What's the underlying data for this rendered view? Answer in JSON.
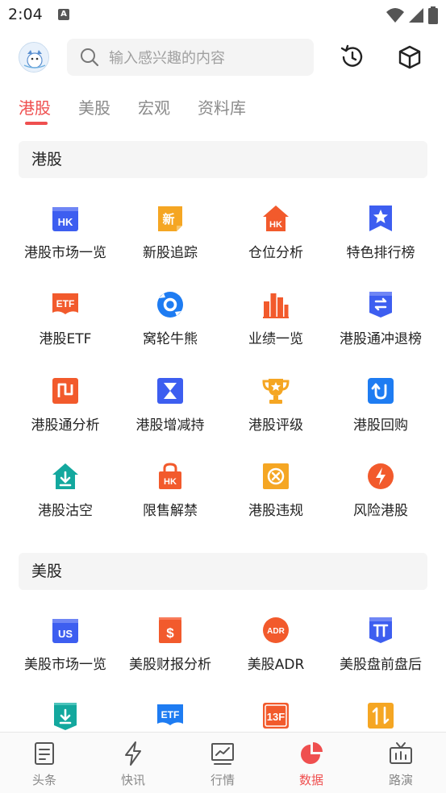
{
  "status": {
    "time": "2:04",
    "notif_badge": "A"
  },
  "search": {
    "placeholder": "输入感兴趣的内容"
  },
  "tabs": [
    {
      "label": "港股",
      "active": true
    },
    {
      "label": "美股",
      "active": false
    },
    {
      "label": "宏观",
      "active": false
    },
    {
      "label": "资料库",
      "active": false
    }
  ],
  "hk": {
    "title": "港股",
    "items": [
      {
        "label": "港股市场一览",
        "icon": "hk-market-icon",
        "glyph": "HK"
      },
      {
        "label": "新股追踪",
        "icon": "new-stock-icon",
        "glyph": "新"
      },
      {
        "label": "仓位分析",
        "icon": "position-analysis-icon",
        "glyph": "HK"
      },
      {
        "label": "特色排行榜",
        "icon": "ranking-icon",
        "glyph": "★"
      },
      {
        "label": "港股ETF",
        "icon": "etf-icon",
        "glyph": "ETF"
      },
      {
        "label": "窝轮牛熊",
        "icon": "warrant-icon",
        "glyph": ""
      },
      {
        "label": "业绩一览",
        "icon": "earnings-icon",
        "glyph": ""
      },
      {
        "label": "港股通冲退榜",
        "icon": "connect-rank-icon",
        "glyph": "⇅"
      },
      {
        "label": "港股通分析",
        "icon": "connect-analysis-icon",
        "glyph": ""
      },
      {
        "label": "港股增减持",
        "icon": "holding-change-icon",
        "glyph": ""
      },
      {
        "label": "港股评级",
        "icon": "rating-trophy-icon",
        "glyph": "★"
      },
      {
        "label": "港股回购",
        "icon": "buyback-icon",
        "glyph": "↻"
      },
      {
        "label": "港股沽空",
        "icon": "short-sell-icon",
        "glyph": ""
      },
      {
        "label": "限售解禁",
        "icon": "lockup-icon",
        "glyph": "HK"
      },
      {
        "label": "港股违规",
        "icon": "violation-icon",
        "glyph": "×"
      },
      {
        "label": "风险港股",
        "icon": "risk-icon",
        "glyph": ""
      }
    ]
  },
  "us": {
    "title": "美股",
    "items": [
      {
        "label": "美股市场一览",
        "icon": "us-market-icon",
        "glyph": "US"
      },
      {
        "label": "美股财报分析",
        "icon": "us-earnings-icon",
        "glyph": "$"
      },
      {
        "label": "美股ADR",
        "icon": "adr-icon",
        "glyph": "ADR"
      },
      {
        "label": "美股盘前盘后",
        "icon": "premarket-icon",
        "glyph": "T"
      },
      {
        "label": "",
        "icon": "us-download-icon",
        "glyph": ""
      },
      {
        "label": "",
        "icon": "us-etf-icon",
        "glyph": "ETF"
      },
      {
        "label": "",
        "icon": "13f-icon",
        "glyph": "13F"
      },
      {
        "label": "",
        "icon": "updown-icon",
        "glyph": "⇅"
      }
    ]
  },
  "bottom_nav": [
    {
      "label": "头条",
      "icon": "news-icon",
      "active": false
    },
    {
      "label": "快讯",
      "icon": "lightning-icon",
      "active": false
    },
    {
      "label": "行情",
      "icon": "market-chart-icon",
      "active": false
    },
    {
      "label": "数据",
      "icon": "pie-chart-icon",
      "active": true
    },
    {
      "label": "路演",
      "icon": "tv-icon",
      "active": false
    }
  ],
  "colors": {
    "accent": "#ef4f4f",
    "blue": "#3d5ef0",
    "orange": "#f5a623",
    "red_orange": "#f25a2c",
    "teal": "#13a89e"
  }
}
